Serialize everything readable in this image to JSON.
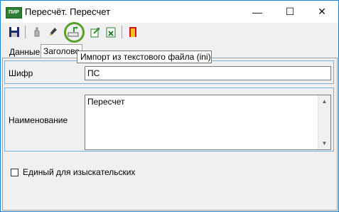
{
  "window": {
    "title": "Пересчёт. Пересчет",
    "app_icon_text": "ПИР"
  },
  "title_controls": {
    "minimize": "—",
    "maximize": "☐",
    "close": "✕"
  },
  "toolbar": {
    "items": [
      {
        "icon": "save-icon"
      },
      {
        "icon": "hand-icon"
      },
      {
        "icon": "pen-icon"
      },
      {
        "icon": "import-ini-icon"
      },
      {
        "icon": "export-icon"
      },
      {
        "icon": "spreadsheet-icon"
      },
      {
        "icon": "exit-icon"
      }
    ]
  },
  "tooltip": {
    "text": "Импорт из текстового файла (ini)"
  },
  "tabs": [
    {
      "label": "Данные"
    },
    {
      "label": "Заголово"
    }
  ],
  "form": {
    "code_label": "Шифр",
    "code_value": "ПС",
    "name_label": "Наименование",
    "name_value": "Пересчет",
    "checkbox_label": "Единый для изыскательских"
  },
  "colors": {
    "group_border": "#7ab0e0",
    "highlight": "#5aa02c",
    "window_border": "#1883d7"
  }
}
